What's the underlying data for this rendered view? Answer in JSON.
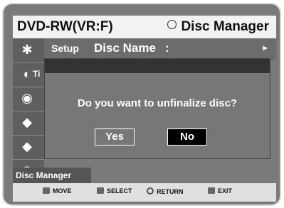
{
  "topbar": {
    "left_title": "DVD-RW(VR:F)",
    "right_title": "Disc Manager"
  },
  "setup": {
    "tab_label": "Setup",
    "field_label": "Disc Name",
    "colon": ":",
    "arrow": "►"
  },
  "sidebar": {
    "partial_label": "Ti"
  },
  "dialog": {
    "question": "Do you want to unfinalize disc?",
    "yes_label": "Yes",
    "no_label": "No"
  },
  "section_tag": "Disc Manager",
  "bottom": {
    "move": "MOVE",
    "select": "SELECT",
    "return": "RETURN",
    "exit": "EXIT"
  }
}
